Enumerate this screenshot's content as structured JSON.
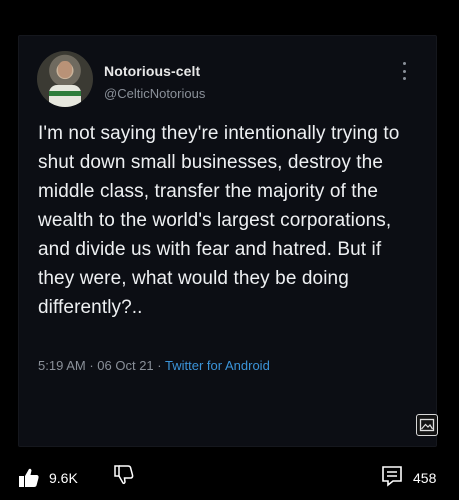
{
  "tweet": {
    "display_name": "Notorious-celt",
    "handle": "@CelticNotorious",
    "text": "I'm not saying they're intentionally trying to shut down small businesses, destroy the middle class, transfer the majority of the wealth to the world's largest corporations, and divide us with fear and hatred. But if they were, what would they be doing differently?..",
    "time": "5:19 AM",
    "date": "06 Oct 21",
    "source": "Twitter for Android",
    "separator": "·"
  },
  "footer": {
    "like_count": "9.6K",
    "comment_count": "458"
  },
  "icons": {
    "more": "more-vertical-icon",
    "image": "image-icon",
    "like": "thumbs-up-icon",
    "dislike": "thumbs-down-icon",
    "comments": "comment-icon"
  },
  "colors": {
    "background": "#000000",
    "card": "#0c0e14",
    "text": "#eef0f2",
    "muted": "#8a9099",
    "link": "#3b94d9"
  }
}
